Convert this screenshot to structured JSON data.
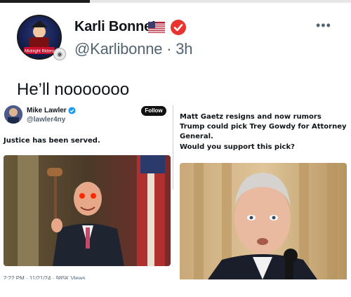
{
  "post": {
    "author_name": "Karli Bonne’",
    "handle_time": "@Karlibonne · 3h",
    "text": "He’ll nooooooo",
    "more_label": "•••",
    "avatar_text": "Midnight Riders"
  },
  "embed": {
    "left": {
      "author_name": "Mike Lawler",
      "handle": "@lawler4ny",
      "follow_label": "Follow",
      "text": "Justice has been served.",
      "footer": "2:22 PM · 11/21/24 · 985K Views"
    },
    "right": {
      "text1": "Matt Gaetz resigns and now rumors Trump could pick Trey Gowdy for Attorney General.",
      "text2": "Would you support this pick?"
    }
  },
  "colors": {
    "verified_red": "#e8332f",
    "verified_blue": "#1d9bf0",
    "handle_gray": "#536471",
    "follow_black": "#111111"
  },
  "icons": {
    "verified": "red-check-badge-icon",
    "flag": "us-flag-icon",
    "more": "more-dots-icon",
    "small_verified": "blue-check-icon"
  }
}
